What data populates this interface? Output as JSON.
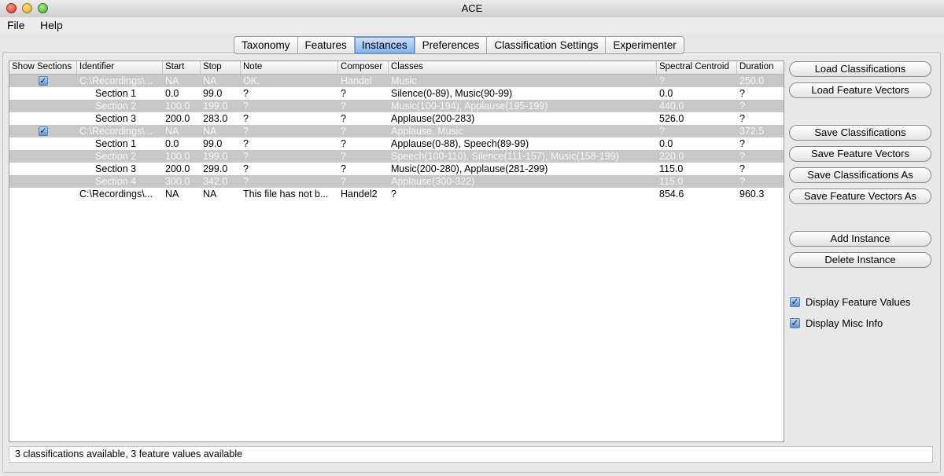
{
  "window": {
    "title": "ACE"
  },
  "menu": {
    "items": [
      "File",
      "Help"
    ]
  },
  "tabs": [
    "Taxonomy",
    "Features",
    "Instances",
    "Preferences",
    "Classification Settings",
    "Experimenter"
  ],
  "active_tab": "Instances",
  "table": {
    "headers": [
      "Show Sections",
      "Identifier",
      "Start",
      "Stop",
      "Note",
      "Composer",
      "Classes",
      "Spectral Centroid",
      "Duration"
    ],
    "rows": [
      {
        "grey": true,
        "checkbox": true,
        "cells": [
          "",
          "C:\\Recordings\\...",
          "NA",
          "NA",
          "OK.",
          "Handel",
          "Music",
          "?",
          "250.0"
        ]
      },
      {
        "grey": false,
        "checkbox": false,
        "cells": [
          "",
          "Section 1",
          "0.0",
          "99.0",
          "?",
          "?",
          "Silence(0-89), Music(90-99)",
          "0.0",
          "?"
        ]
      },
      {
        "grey": true,
        "checkbox": false,
        "cells": [
          "",
          "Section 2",
          "100.0",
          "199.0",
          "?",
          "?",
          "Music(100-194), Applause(195-199)",
          "440.0",
          "?"
        ]
      },
      {
        "grey": false,
        "checkbox": false,
        "cells": [
          "",
          "Section 3",
          "200.0",
          "283.0",
          "?",
          "?",
          "Applause(200-283)",
          "526.0",
          "?"
        ]
      },
      {
        "grey": true,
        "checkbox": true,
        "cells": [
          "",
          "C:\\Recordings\\...",
          "NA",
          "NA",
          "?",
          "?",
          "Applause, Music",
          "?",
          "372.5"
        ]
      },
      {
        "grey": false,
        "checkbox": false,
        "cells": [
          "",
          "Section 1",
          "0.0",
          "99.0",
          "?",
          "?",
          "Applause(0-88), Speech(89-99)",
          "0.0",
          "?"
        ]
      },
      {
        "grey": true,
        "checkbox": false,
        "cells": [
          "",
          "Section 2",
          "100.0",
          "199.0",
          "?",
          "?",
          "Speech(100-110), Silence(111-157), Music(158-199)",
          "220.0",
          "?"
        ]
      },
      {
        "grey": false,
        "checkbox": false,
        "cells": [
          "",
          "Section 3",
          "200.0",
          "299.0",
          "?",
          "?",
          "Music(200-280), Applause(281-299)",
          "115.0",
          "?"
        ]
      },
      {
        "grey": true,
        "checkbox": false,
        "cells": [
          "",
          "Section 4",
          "300.0",
          "342.0",
          "?",
          "?",
          "Applause(300-322)",
          "115.0",
          "?"
        ]
      },
      {
        "grey": false,
        "checkbox": false,
        "cells": [
          "",
          "C:\\Recordings\\...",
          "NA",
          "NA",
          "This file has not b...",
          "Handel2",
          "?",
          "854.6",
          "960.3"
        ]
      }
    ]
  },
  "buttons": {
    "load_classifications": "Load Classifications",
    "load_feature_vectors": "Load Feature Vectors",
    "save_classifications": "Save Classifications",
    "save_feature_vectors": "Save Feature Vectors",
    "save_classifications_as": "Save Classifications As",
    "save_feature_vectors_as": "Save Feature Vectors As",
    "add_instance": "Add Instance",
    "delete_instance": "Delete Instance"
  },
  "options": {
    "display_feature_values": {
      "label": "Display Feature Values",
      "checked": true
    },
    "display_misc_info": {
      "label": "Display Misc Info",
      "checked": true
    }
  },
  "status": "3 classifications available, 3 feature values available"
}
